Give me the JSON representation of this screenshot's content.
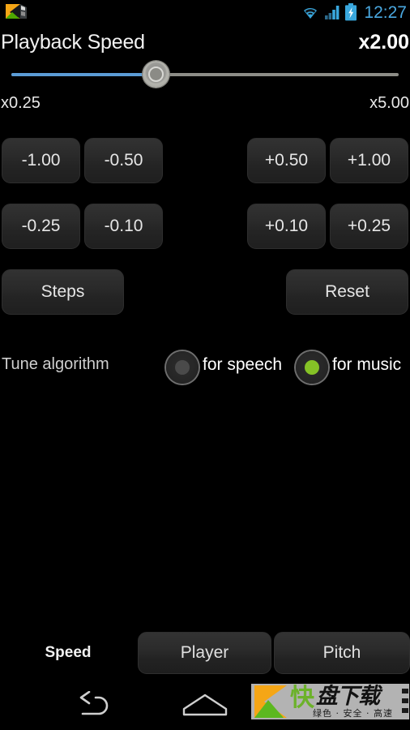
{
  "statusbar": {
    "app_icon": "app-notification-icon",
    "wifi_icon": "wifi-icon",
    "signal_icon": "cellular-signal-icon",
    "battery_icon": "battery-charging-icon",
    "clock": "12:27",
    "accent_color": "#4aa8e0"
  },
  "header": {
    "title": "Playback Speed",
    "value": "x2.00"
  },
  "slider": {
    "name": "playback-speed-slider",
    "min_label": "x0.25",
    "max_label": "x5.00",
    "min": 0.25,
    "max": 5.0,
    "value": 2.0,
    "fill_color": "#5b9bd5",
    "track_color": "#8d8d87"
  },
  "steps": {
    "row1": [
      {
        "label": "-1.00",
        "side": "left"
      },
      {
        "label": "-0.50",
        "side": "left"
      },
      {
        "label": "+0.50",
        "side": "right"
      },
      {
        "label": "+1.00",
        "side": "right"
      }
    ],
    "row2": [
      {
        "label": "-0.25",
        "side": "left"
      },
      {
        "label": "-0.10",
        "side": "left"
      },
      {
        "label": "+0.10",
        "side": "right"
      },
      {
        "label": "+0.25",
        "side": "right"
      }
    ],
    "steps_label": "Steps",
    "reset_label": "Reset"
  },
  "tune": {
    "label": "Tune algorithm",
    "options": [
      {
        "label": "for speech",
        "selected": false
      },
      {
        "label": "for music",
        "selected": true
      }
    ],
    "selected_color": "#85c226"
  },
  "tabs": [
    {
      "label": "Speed",
      "active": true
    },
    {
      "label": "Player",
      "active": false
    },
    {
      "label": "Pitch",
      "active": false
    }
  ],
  "navbar": {
    "back_icon": "back-arrow-icon",
    "home_icon": "home-icon"
  },
  "watermark": {
    "brand": "快",
    "brand2": "盘下载",
    "tagline": "绿色 · 安全 · 高速",
    "bg_color": "#b3b3b3"
  }
}
